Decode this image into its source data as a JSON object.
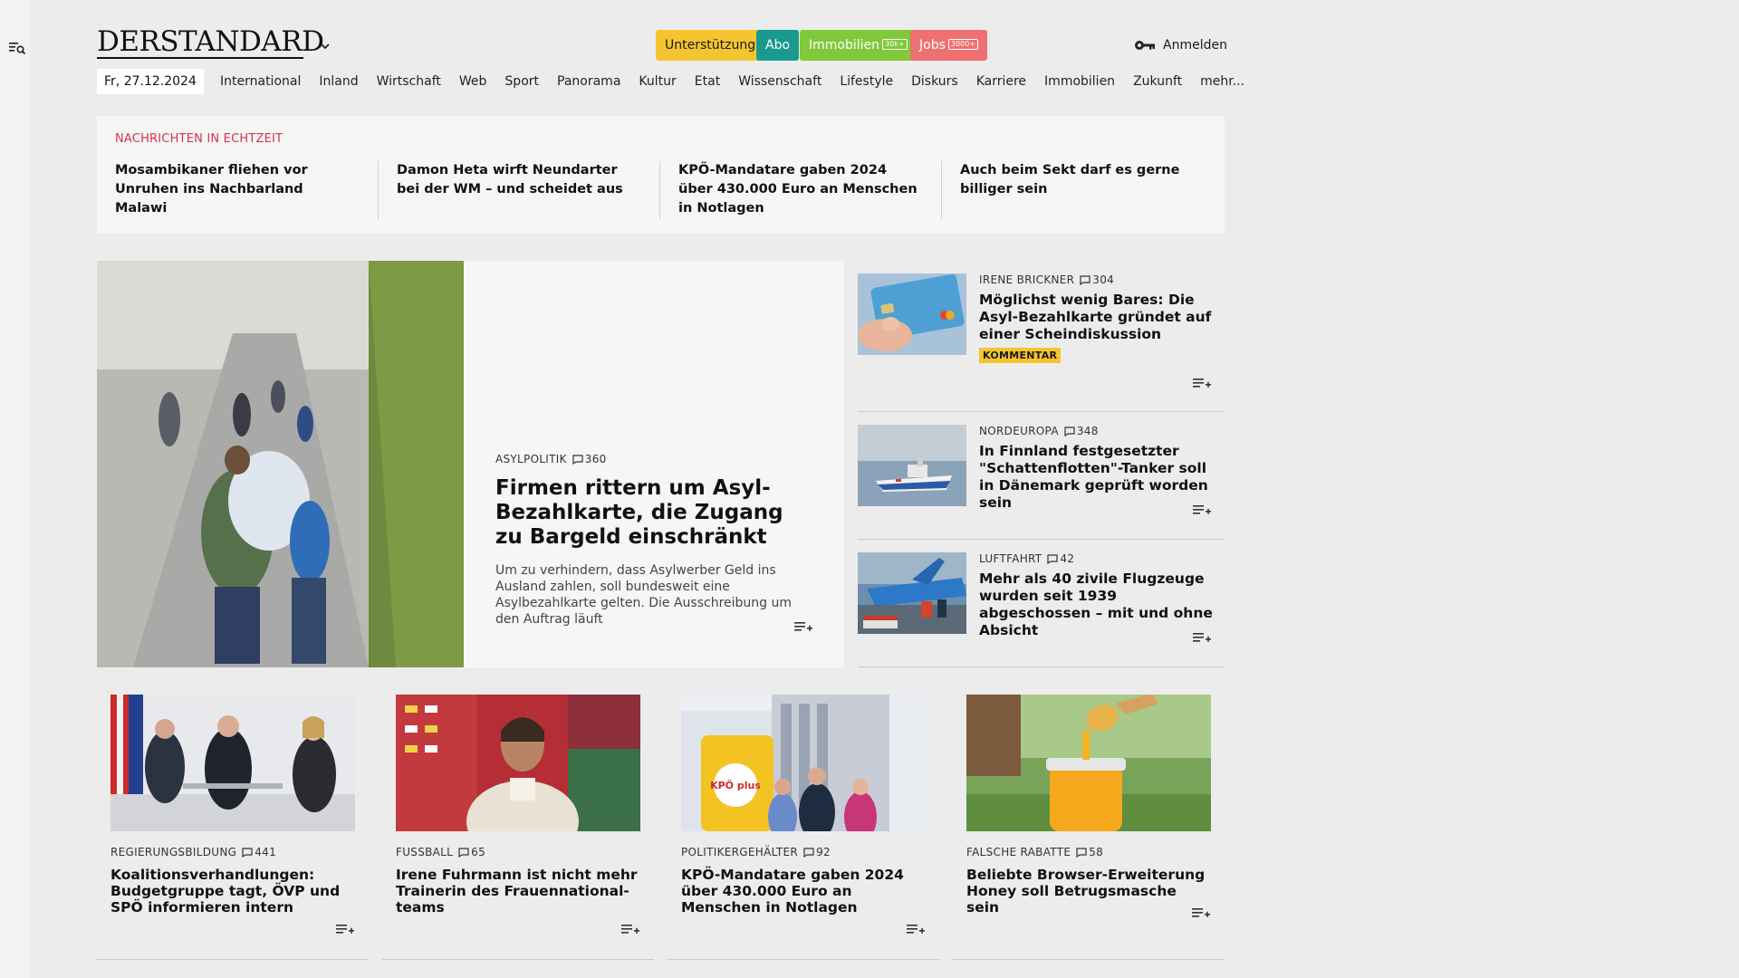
{
  "header": {
    "logo": "DERSTANDARD",
    "pills": {
      "support": "Unterstützung",
      "abo": "Abo",
      "immo": "Immobilien",
      "immo_tag": "30k+",
      "jobs": "Jobs",
      "jobs_tag": "3000+"
    },
    "login": "Anmelden"
  },
  "nav": {
    "date": "Fr, 27.12.2024",
    "items": [
      "International",
      "Inland",
      "Wirtschaft",
      "Web",
      "Sport",
      "Panorama",
      "Kultur",
      "Etat",
      "Wissenschaft",
      "Lifestyle",
      "Diskurs",
      "Karriere",
      "Immobilien",
      "Zukunft",
      "mehr..."
    ]
  },
  "ticker": {
    "heading": "NACHRICHTEN IN ECHTZEIT",
    "items": [
      "Mosambikaner fliehen vor Unruhen ins Nachbarland Malawi",
      "Damon Heta wirft Neundarter bei der WM – und scheidet aus",
      "KPÖ-Mandatare gaben 2024 über 430.000 Euro an Menschen in Notlagen",
      "Auch beim Sekt darf es gerne billiger sein"
    ]
  },
  "lead": {
    "kicker": "ASYLPOLITIK",
    "comments": "360",
    "title": "Firmen rittern um Asyl-Bezahl­karte, die Zugang zu Bargeld einschränkt",
    "teaser": "Um zu verhindern, dass Asylwerber Geld ins Ausland zahlen, soll bundesweit eine Asylbezahlkarte gelten. Die Ausschreibung um den Auftrag läuft"
  },
  "side": [
    {
      "kicker": "IRENE BRICKNER",
      "comments": "304",
      "title": "Möglichst wenig Bares: Die Asyl-Bezahlkarte gründet auf einer Scheindiskussion",
      "badge": "KOMMENTAR"
    },
    {
      "kicker": "NORDEUROPA",
      "comments": "348",
      "title": "In Finnland festgesetzter \"Schat­tenflotten\"-Tanker soll in Dänemark geprüft worden sein"
    },
    {
      "kicker": "LUFTFAHRT",
      "comments": "42",
      "title": "Mehr als 40 zivile Flugzeuge wurden seit 1939 abgeschossen – mit und ohne Absicht"
    }
  ],
  "cards": [
    {
      "kicker": "REGIERUNGSBILDUNG",
      "comments": "441",
      "title": "Koalitionsverhandlungen: Budgetgruppe tagt, ÖVP und SPÖ informieren intern"
    },
    {
      "kicker": "FUSSBALL",
      "comments": "65",
      "title": "Irene Fuhrmann ist nicht mehr Trainerin des Frauennational­teams"
    },
    {
      "kicker": "POLITIKERGEHÄLTER",
      "comments": "92",
      "title": "KPÖ-Mandatare gaben 2024 über 430.000 Euro an Menschen in Notlagen"
    },
    {
      "kicker": "FALSCHE RABATTE",
      "comments": "58",
      "title": "Beliebte Browser-Erweiterung Honey soll Betrugsmasche sein"
    }
  ],
  "images": {
    "card3_logo": "KPÖ plus"
  },
  "colors": {
    "ticker_heading": "#d6334a",
    "support": "#f4c530",
    "abo": "#1a9a8e",
    "immo": "#7fc93a",
    "jobs": "#ee7070",
    "badge": "#f4c530"
  }
}
